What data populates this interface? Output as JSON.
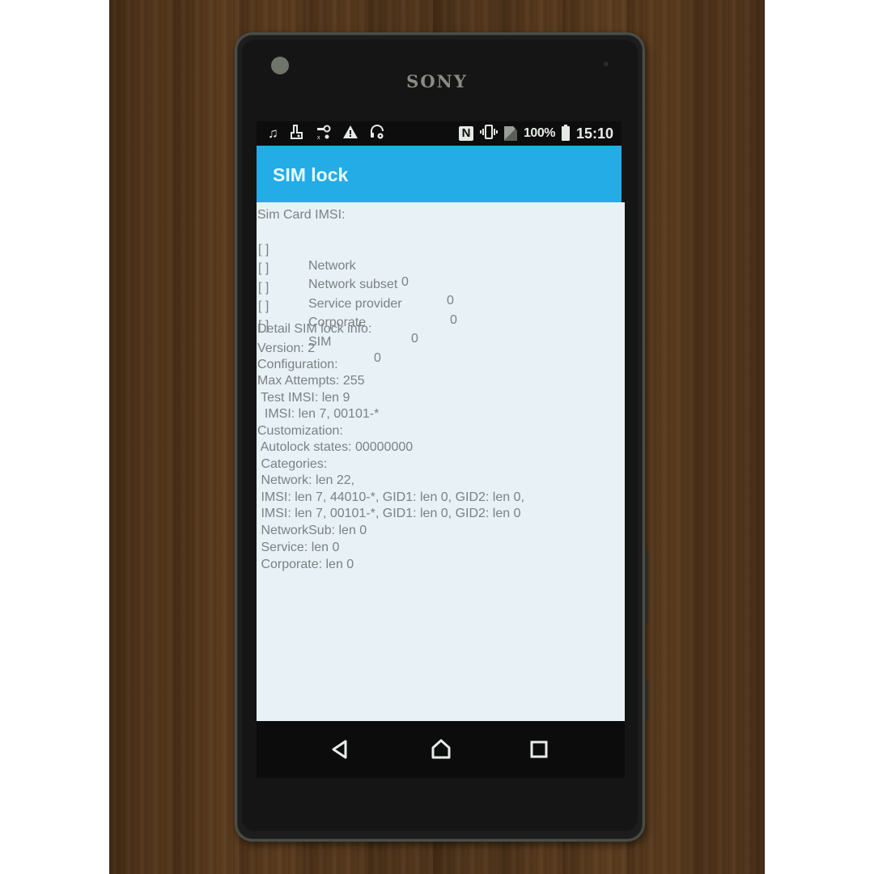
{
  "device": {
    "brand": "SONY"
  },
  "status_bar": {
    "left_icons": [
      "music-note-icon",
      "usb-debug-icon",
      "key-icon",
      "warning-icon",
      "headset-icon"
    ],
    "right_icons": [
      "nfc-icon",
      "vibrate-icon",
      "no-sim-icon"
    ],
    "nfc_glyph": "N",
    "battery_percent": "100%",
    "time": "15:10"
  },
  "app_bar": {
    "title": "SIM lock",
    "color": "#23ace6"
  },
  "content": {
    "sim_imsi_header": "Sim Card IMSI:",
    "lock_rows": [
      {
        "check": "[ ]",
        "label": "Network",
        "value": "0"
      },
      {
        "check": "[ ]",
        "label": "Network subset",
        "value": "0"
      },
      {
        "check": "[ ]",
        "label": "Service provider",
        "value": "0"
      },
      {
        "check": "[ ]",
        "label": "Corporate",
        "value": "0"
      },
      {
        "check": "[ ]",
        "label": "SIM",
        "value": "0"
      }
    ],
    "detail_lines": [
      {
        "text": "Detail SIM lock info:",
        "indent": false
      },
      {
        "text": "Version: 2",
        "indent": false
      },
      {
        "text": "Configuration:",
        "indent": false
      },
      {
        "text": "Max Attempts: 255",
        "indent": false
      },
      {
        "text": " Test IMSI: len 9",
        "indent": false
      },
      {
        "text": "  IMSI: len 7, 00101-*",
        "indent": false
      },
      {
        "text": "Customization:",
        "indent": false
      },
      {
        "text": " Autolock states: 00000000",
        "indent": false
      },
      {
        "text": " Categories:",
        "indent": false
      },
      {
        "text": " Network: len 22,",
        "indent": false
      },
      {
        "text": " IMSI: len 7, 44010-*, GID1: len 0, GID2: len 0,",
        "indent": false
      },
      {
        "text": " IMSI: len 7, 00101-*, GID1: len 0, GID2: len 0",
        "indent": false
      },
      {
        "text": " NetworkSub: len 0",
        "indent": false
      },
      {
        "text": " Service: len 0",
        "indent": false
      },
      {
        "text": " Corporate: len 0",
        "indent": false
      }
    ]
  },
  "nav_bar": {
    "back": "back-icon",
    "home": "home-icon",
    "recents": "recents-icon"
  }
}
